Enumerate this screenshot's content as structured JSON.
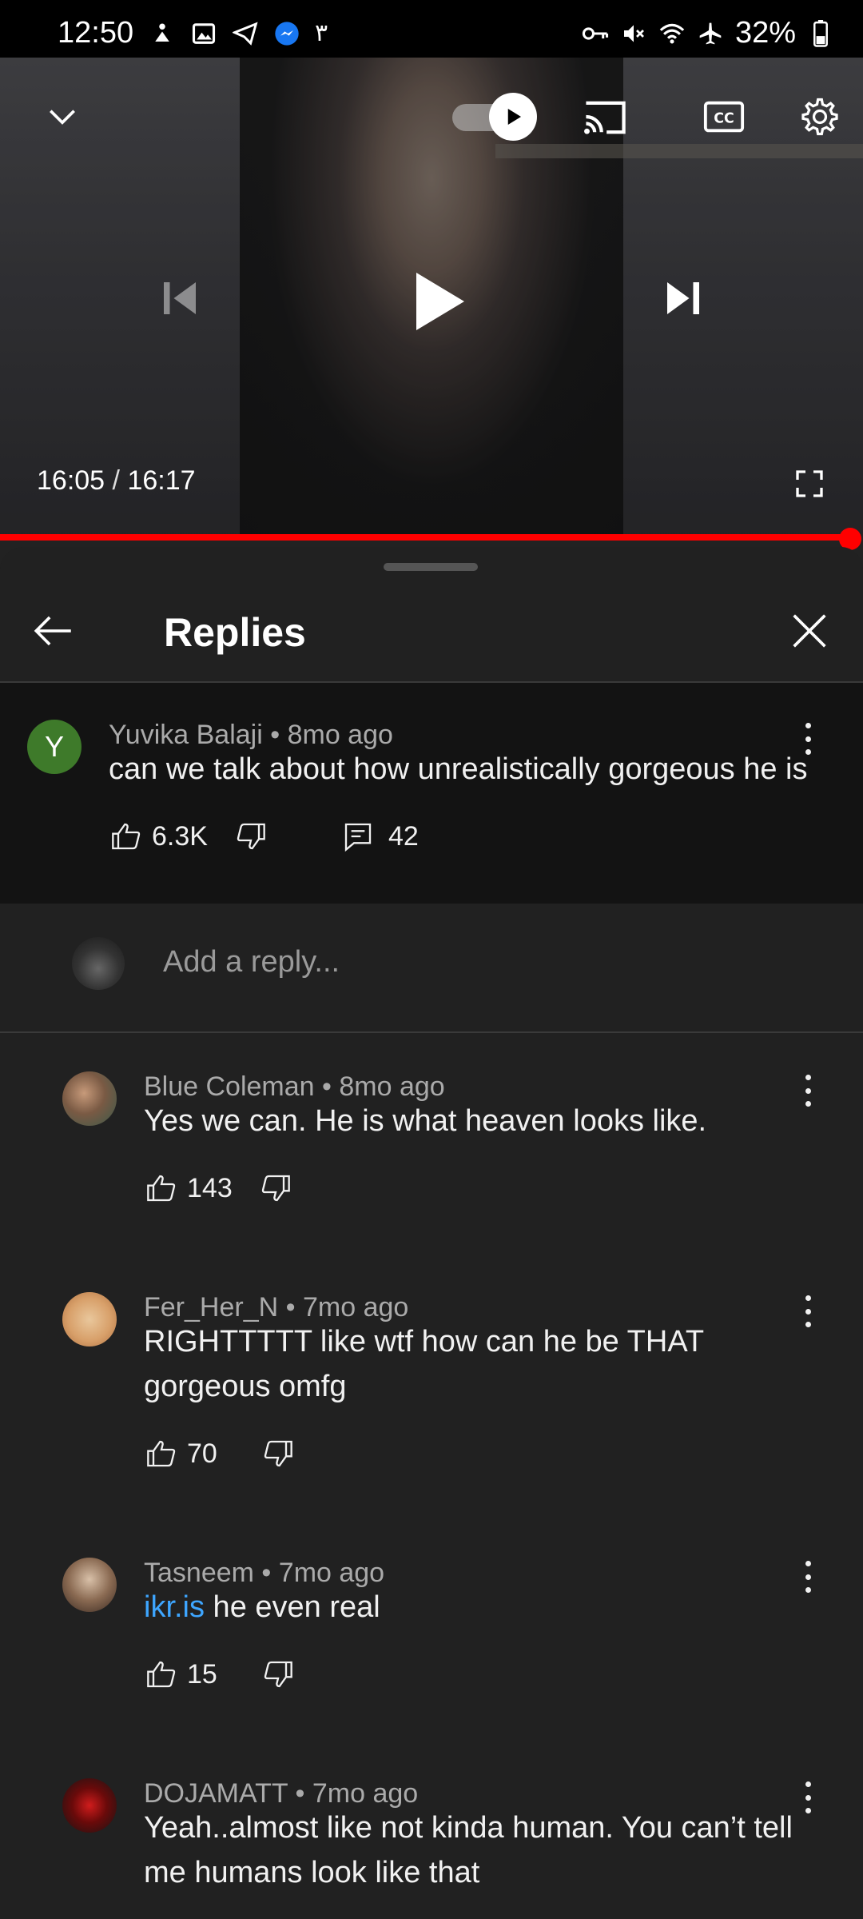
{
  "status_bar": {
    "time": "12:50",
    "extra_glyph": "٣",
    "battery": "32%",
    "icons_left": [
      "accessibility-icon",
      "gallery-icon",
      "telegram-icon",
      "messenger-icon"
    ],
    "icons_right": [
      "vpn-key-icon",
      "mute-icon",
      "wifi-icon",
      "airplane-icon",
      "battery-icon"
    ]
  },
  "player": {
    "current_time": "16:05",
    "separator": "/",
    "duration": "16:17",
    "progress_percent": 99,
    "autoplay_on": true,
    "accent_color": "#ff0000"
  },
  "sheet": {
    "title": "Replies"
  },
  "parent_comment": {
    "avatar_letter": "Y",
    "author": "Yuvika Balaji",
    "time": "8mo ago",
    "text": "can we talk about how unrealistically gorgeous he is",
    "likes": "6.3K",
    "replies": "42"
  },
  "reply_box": {
    "placeholder": "Add a reply..."
  },
  "replies": [
    {
      "author": "Blue Coleman",
      "time": "8mo ago",
      "text": "Yes we can. He is what heaven looks like.",
      "likes": "143"
    },
    {
      "author": "Fer_Her_N",
      "time": "7mo ago",
      "text_line1": "RIGHTTTTT like wtf how can he be THAT",
      "text_line2": "gorgeous omfg",
      "likes": "70"
    },
    {
      "author": "Tasneem",
      "time": "7mo ago",
      "link": "ikr.is",
      "text": " he even real",
      "likes": "15"
    },
    {
      "author": "DOJAMATT",
      "time": "7mo ago",
      "text_line1": "Yeah..almost like not kinda human. You can’t tell",
      "text_line2": "me humans look like that"
    }
  ],
  "dot_separator": "•"
}
